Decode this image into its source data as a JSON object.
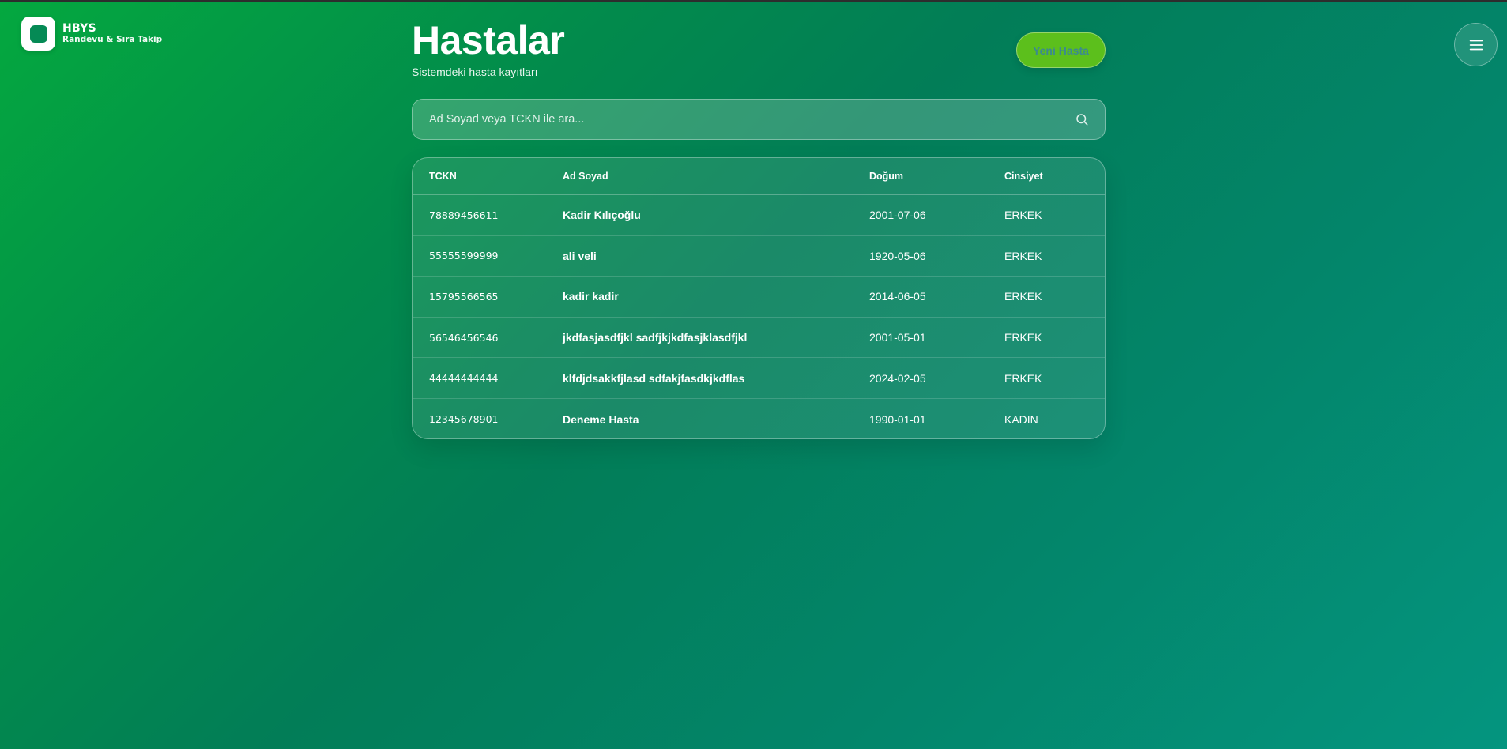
{
  "brand": {
    "title": "HBYS",
    "subtitle": "Randevu & Sıra Takip"
  },
  "header": {
    "title": "Hastalar",
    "subtitle": "Sistemdeki hasta kayıtları",
    "new_button_label": "Yeni Hasta"
  },
  "search": {
    "placeholder": "Ad Soyad veya TCKN ile ara...",
    "value": ""
  },
  "table": {
    "columns": [
      "TCKN",
      "Ad Soyad",
      "Doğum",
      "Cinsiyet"
    ],
    "rows": [
      [
        "78889456611",
        "Kadir Kılıçoğlu",
        "2001-07-06",
        "ERKEK"
      ],
      [
        "55555599999",
        "ali veli",
        "1920-05-06",
        "ERKEK"
      ],
      [
        "15795566565",
        "kadir kadir",
        "2014-06-05",
        "ERKEK"
      ],
      [
        "56546456546",
        "jkdfasjasdfjkl sadfjkjkdfasjklasdfjkl",
        "2001-05-01",
        "ERKEK"
      ],
      [
        "44444444444",
        "klfdjdsakkfjlasd sdfakjfasdkjkdflas",
        "2024-02-05",
        "ERKEK"
      ],
      [
        "12345678901",
        "Deneme Hasta",
        "1990-01-01",
        "KADIN"
      ]
    ]
  },
  "icons": {
    "menu": "hamburger-menu-icon",
    "search": "search-icon",
    "logo": "app-logo-icon"
  },
  "colors": {
    "accent_button": "#5cbf1c",
    "background_start": "#04a83f",
    "background_end": "#04957f"
  }
}
